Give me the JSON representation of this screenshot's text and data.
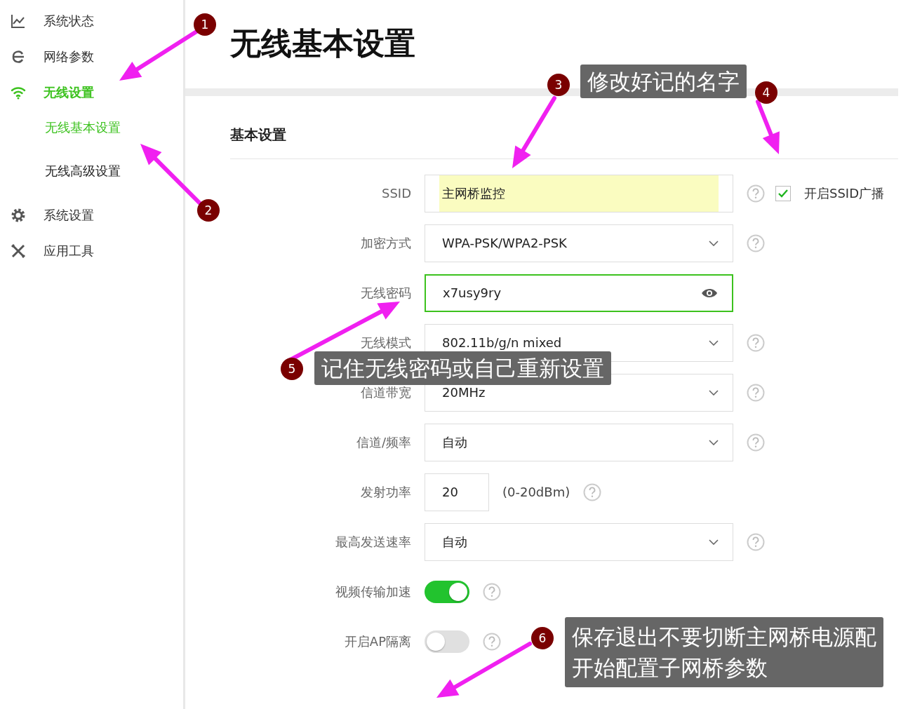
{
  "sidebar": {
    "items": [
      {
        "label": "系统状态",
        "selected": false
      },
      {
        "label": "网络参数",
        "selected": false
      },
      {
        "label": "无线设置",
        "selected": true,
        "children": [
          {
            "label": "无线基本设置",
            "selected": true
          },
          {
            "label": "无线高级设置",
            "selected": false
          }
        ]
      },
      {
        "label": "系统设置",
        "selected": false
      },
      {
        "label": "应用工具",
        "selected": false
      }
    ]
  },
  "page_title": "无线基本设置",
  "section_title": "基本设置",
  "fields": [
    {
      "kind": "text",
      "label": "SSID",
      "value": "主网桥监控",
      "help": true,
      "focused": false,
      "autofilled": true,
      "checkbox": {
        "label": "开启SSID广播",
        "checked": true
      }
    },
    {
      "kind": "select",
      "label": "加密方式",
      "value": "WPA-PSK/WPA2-PSK",
      "help": true,
      "focused": false
    },
    {
      "kind": "password",
      "label": "无线密码",
      "value": "x7usy9ry",
      "help": false,
      "focused": true
    },
    {
      "kind": "select",
      "label": "无线模式",
      "value": "802.11b/g/n mixed",
      "help": true,
      "focused": false
    },
    {
      "kind": "select",
      "label": "信道带宽",
      "value": "20MHz",
      "help": true,
      "focused": false
    },
    {
      "kind": "select",
      "label": "信道/频率",
      "value": "自动",
      "help": true,
      "focused": false
    },
    {
      "kind": "power",
      "label": "发射功率",
      "value": "20",
      "unit": "(0-20dBm)",
      "help": true,
      "focused": false
    },
    {
      "kind": "select",
      "label": "最高发送速率",
      "value": "自动",
      "help": true,
      "focused": false
    },
    {
      "kind": "toggle",
      "label": "视频传输加速",
      "on": true,
      "help": true
    },
    {
      "kind": "toggle",
      "label": "开启AP隔离",
      "on": false,
      "help": true
    }
  ],
  "annotations": [
    {
      "number": "1"
    },
    {
      "number": "2"
    },
    {
      "number": "3",
      "lines": [
        "修改好记的名字"
      ]
    },
    {
      "number": "4"
    },
    {
      "number": "5",
      "lines": [
        "记住无线密码或自己重新设置"
      ]
    },
    {
      "number": "6",
      "lines": [
        "保存退出不要切断主网桥电源配",
        "开始配置子网桥参数"
      ]
    }
  ]
}
